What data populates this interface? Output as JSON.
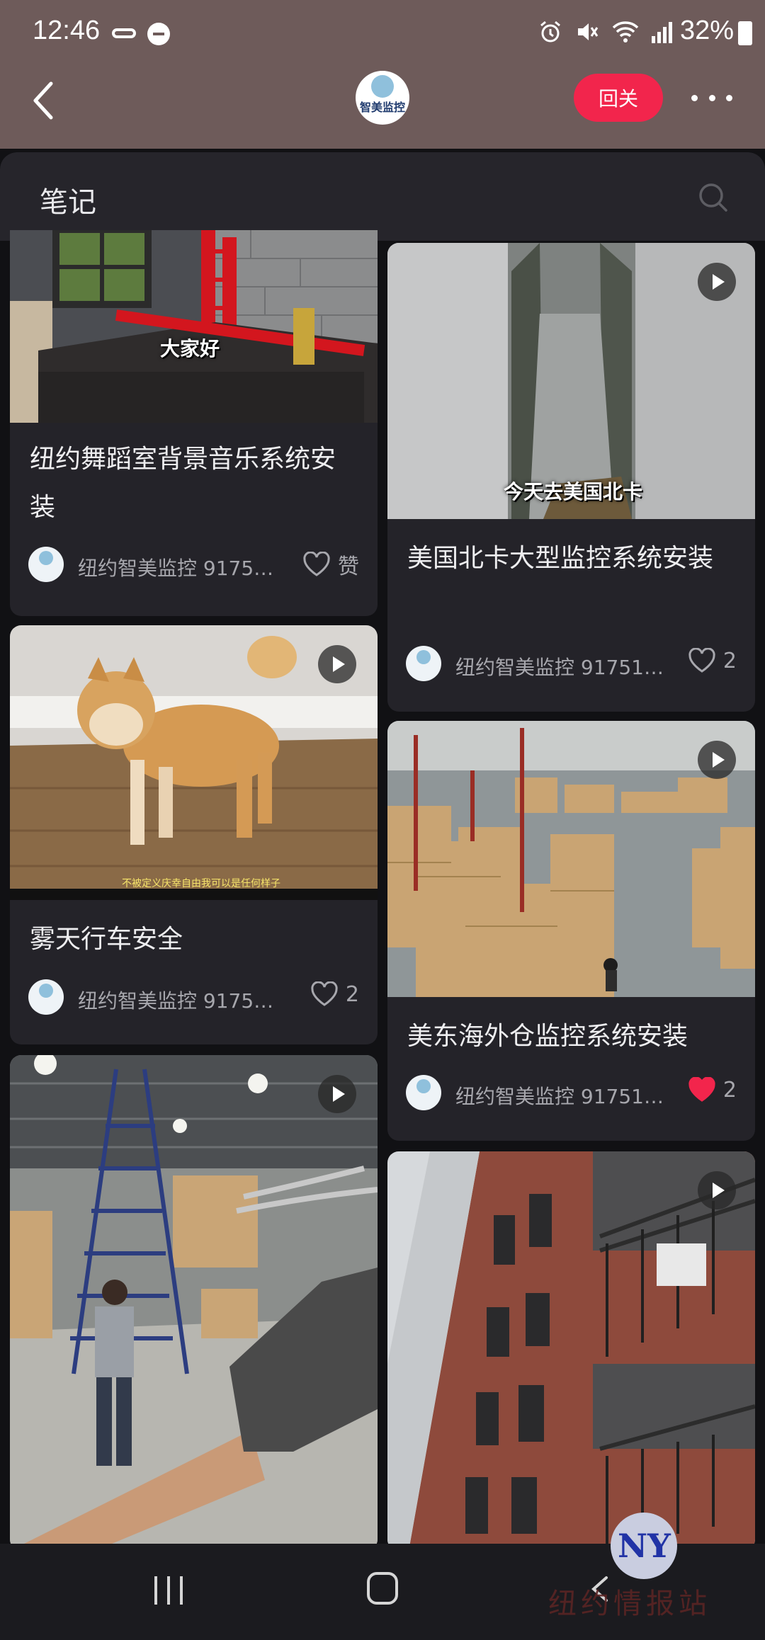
{
  "status_bar": {
    "time": "12:46",
    "battery": "32%",
    "icons": [
      "voicemail-icon",
      "dnd-icon",
      "alarm-icon",
      "mute-icon",
      "wifi-icon",
      "signal-icon",
      "battery-icon"
    ]
  },
  "header": {
    "logo_text": "智美监控",
    "follow_label": "回关"
  },
  "sheet": {
    "title": "笔记"
  },
  "cards": [
    {
      "title": "纽约舞蹈室背景音乐系统安装",
      "author": "纽约智美监控 91751...",
      "likes": "赞",
      "liked": false,
      "overlay": "大家好",
      "is_video": false
    },
    {
      "title": "美国北卡大型监控系统安装",
      "author": "纽约智美监控 917514...",
      "likes": "2",
      "liked": false,
      "overlay": "今天去美国北卡",
      "is_video": true
    },
    {
      "title": "雾天行车安全",
      "author": "纽约智美监控 917514...",
      "likes": "2",
      "liked": false,
      "overlay": "不被定义庆幸自由我可以是任何样子",
      "is_video": true
    },
    {
      "title": "美东海外仓监控系统安装",
      "author": "纽约智美监控 917514...",
      "likes": "2",
      "liked": true,
      "overlay": "",
      "is_video": true
    },
    {
      "title": "",
      "author": "",
      "likes": "",
      "liked": false,
      "overlay": "",
      "is_video": true
    },
    {
      "title": "",
      "author": "",
      "likes": "",
      "liked": false,
      "overlay": "",
      "is_video": true
    }
  ],
  "watermark": {
    "text": "纽约情报站",
    "logo": "NY"
  },
  "colors": {
    "accent": "#f2254c",
    "header_bg": "#6e5b5a",
    "card_bg": "#242329",
    "liked_heart": "#f2254c"
  }
}
